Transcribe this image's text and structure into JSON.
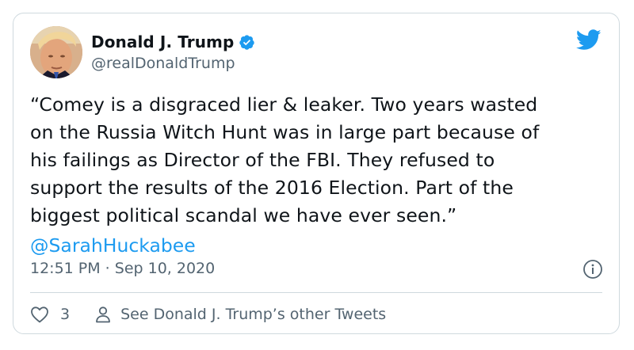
{
  "author": {
    "name": "Donald J. Trump",
    "handle": "@realDonaldTrump",
    "verified": true,
    "avatar": "profile-photo"
  },
  "tweet": {
    "text": "“Comey is a disgraced lier & leaker. Two years wasted\non the Russia Witch Hunt was in large part because of\nhis failings as Director of the FBI. They refused to\nsupport the results of the 2016 Election. Part of the\nbiggest political scandal we have ever seen.”",
    "mention": "@SarahHuckabee",
    "timestamp": "12:51 PM · Sep 10, 2020"
  },
  "actions": {
    "like_count": "3",
    "other_tweets_label": "See Donald J. Trump’s other Tweets"
  },
  "icons": {
    "brand": "twitter-bird-icon",
    "verified": "verified-badge-icon",
    "info": "info-icon",
    "like": "heart-icon",
    "profile": "person-icon"
  },
  "colors": {
    "brand_blue": "#1d9bf0",
    "text": "#0f1419",
    "secondary_text": "#536471",
    "border": "#cfd9de"
  }
}
